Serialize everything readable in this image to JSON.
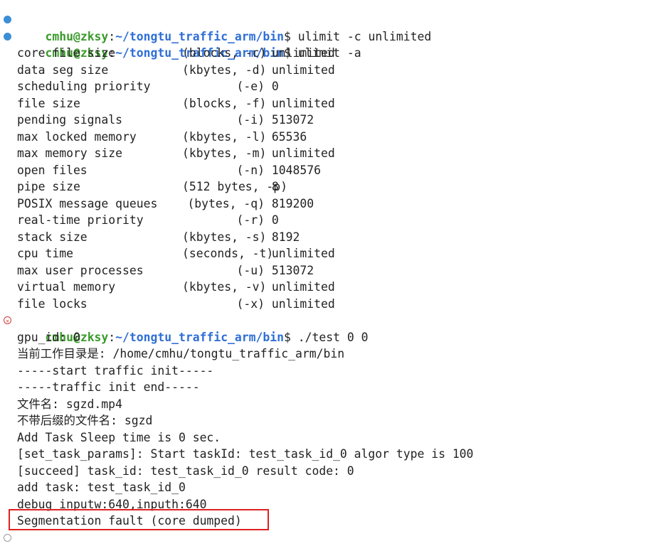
{
  "prompt": {
    "user": "cmhu@zksy",
    "path": "~/tongtu_traffic_arm/bin",
    "symbol": "$"
  },
  "commands": [
    {
      "status": "ok",
      "text": "ulimit -c unlimited"
    },
    {
      "status": "ok",
      "text": "ulimit -a"
    }
  ],
  "ulimit_rows": [
    {
      "name": "core file size",
      "unit": "(blocks, -c)",
      "value": "unlimited"
    },
    {
      "name": "data seg size",
      "unit": "(kbytes, -d)",
      "value": "unlimited"
    },
    {
      "name": "scheduling priority",
      "unit": "(-e)",
      "value": "0"
    },
    {
      "name": "file size",
      "unit": "(blocks, -f)",
      "value": "unlimited"
    },
    {
      "name": "pending signals",
      "unit": "(-i)",
      "value": "513072"
    },
    {
      "name": "max locked memory",
      "unit": "(kbytes, -l)",
      "value": "65536"
    },
    {
      "name": "max memory size",
      "unit": "(kbytes, -m)",
      "value": "unlimited"
    },
    {
      "name": "open files",
      "unit": "(-n)",
      "value": "1048576"
    },
    {
      "name": "pipe size",
      "unit": "(512 bytes, -p)",
      "value": "8"
    },
    {
      "name": "POSIX message queues",
      "unit": "(bytes, -q)",
      "value": "819200"
    },
    {
      "name": "real-time priority",
      "unit": "(-r)",
      "value": "0"
    },
    {
      "name": "stack size",
      "unit": "(kbytes, -s)",
      "value": "8192"
    },
    {
      "name": "cpu time",
      "unit": "(seconds, -t)",
      "value": "unlimited"
    },
    {
      "name": "max user processes",
      "unit": "(-u)",
      "value": "513072"
    },
    {
      "name": "virtual memory",
      "unit": "(kbytes, -v)",
      "value": "unlimited"
    },
    {
      "name": "file locks",
      "unit": "(-x)",
      "value": "unlimited"
    }
  ],
  "run_command": {
    "status": "error",
    "text": "./test 0 0"
  },
  "program_output": [
    "gpu_id: 0",
    "当前工作目录是: /home/cmhu/tongtu_traffic_arm/bin",
    "-----start traffic init-----",
    "-----traffic init end-----",
    "文件名: sgzd.mp4",
    "不带后缀的文件名: sgzd",
    "Add Task Sleep time is 0 sec.",
    "[set_task_params]: Start taskId: test_task_id_0 algor type is 100",
    "[succeed] task_id: test_task_id_0 result code: 0",
    "add task: test_task_id_0",
    "debug inputw:640,inputh:640"
  ],
  "segfault": "Segmentation fault (core dumped)",
  "colors": {
    "user": "#3a9a2a",
    "path": "#2f6fd6",
    "highlight": "#e02020",
    "ok_marker": "#3b8fd6",
    "error_marker": "#d03a3a"
  }
}
